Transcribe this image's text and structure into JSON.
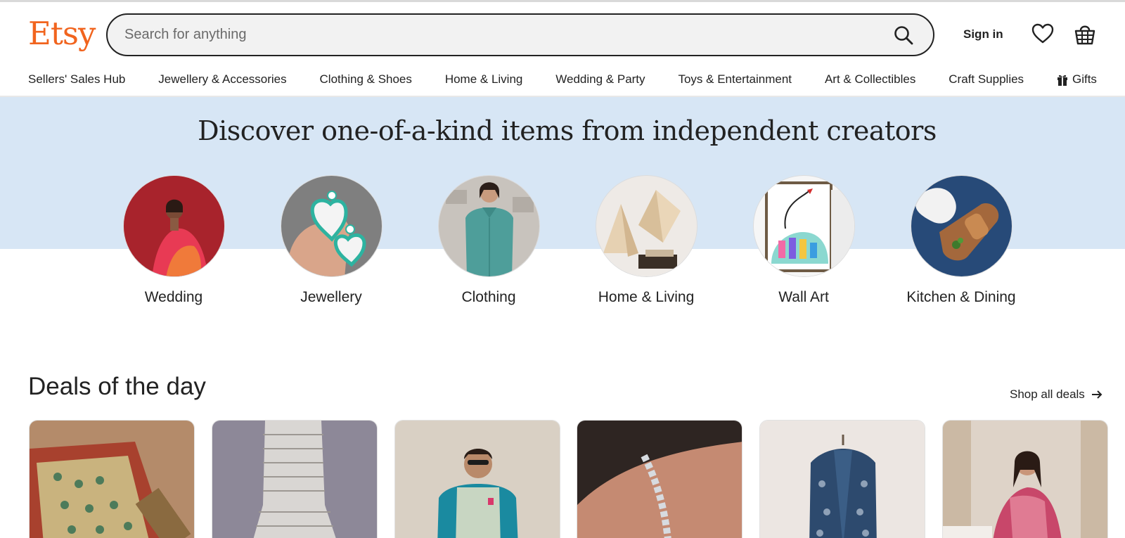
{
  "header": {
    "logo": "Etsy",
    "search_placeholder": "Search for anything",
    "sign_in": "Sign in"
  },
  "nav": {
    "items": [
      "Sellers' Sales Hub",
      "Jewellery & Accessories",
      "Clothing & Shoes",
      "Home & Living",
      "Wedding & Party",
      "Toys & Entertainment",
      "Art & Collectibles",
      "Craft Supplies",
      "Gifts"
    ]
  },
  "hero": {
    "title": "Discover one-of-a-kind items from independent creators",
    "categories": [
      "Wedding",
      "Jewellery",
      "Clothing",
      "Home & Living",
      "Wall Art",
      "Kitchen & Dining"
    ]
  },
  "deals": {
    "title": "Deals of the day",
    "shop_all": "Shop all deals"
  },
  "icons": {
    "search": "search-icon",
    "favorites": "heart-icon",
    "cart": "basket-icon",
    "gift": "gift-icon",
    "arrow": "arrow-right-icon"
  },
  "colors": {
    "brand": "#f1641e",
    "hero_band": "#d7e6f5",
    "text": "#222222"
  }
}
